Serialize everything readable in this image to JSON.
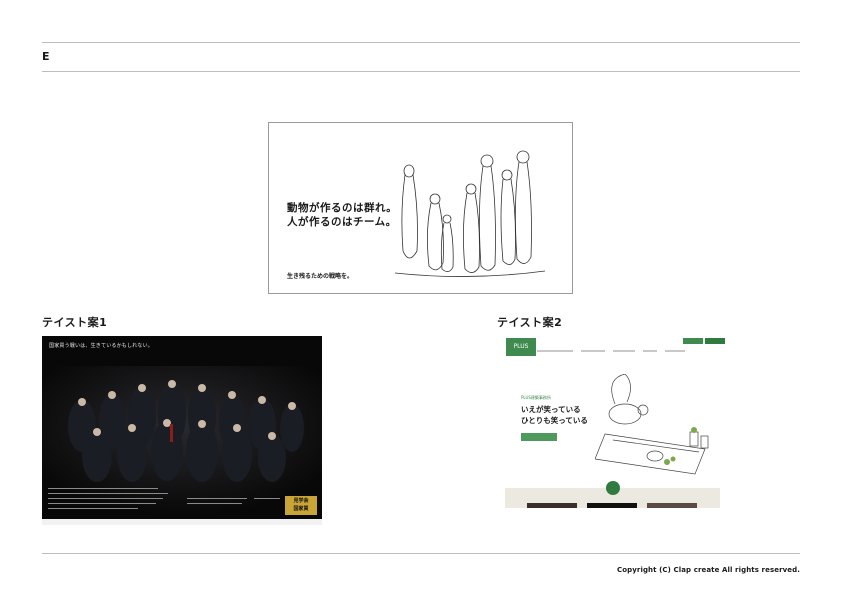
{
  "section": {
    "letter": "E"
  },
  "main_ad": {
    "headline_line1": "動物が作るのは群れ。",
    "headline_line2": "人が作るのはチーム。",
    "subcopy": "生き残るための戦略を。"
  },
  "taste1": {
    "caption": "テイスト案1",
    "lead": "国家買う戦いは、生きているかもしれない。",
    "badge_line1": "見学会",
    "badge_line2": "国家買"
  },
  "taste2": {
    "caption": "テイスト案2",
    "logo": "PLUS",
    "tagline": "PLUS建築事務所",
    "copy_line1": "いえが笑っている",
    "copy_line2": "ひとりも笑っている"
  },
  "footer": {
    "copyright": "Copyright (C)  Clap create All rights reserved."
  }
}
